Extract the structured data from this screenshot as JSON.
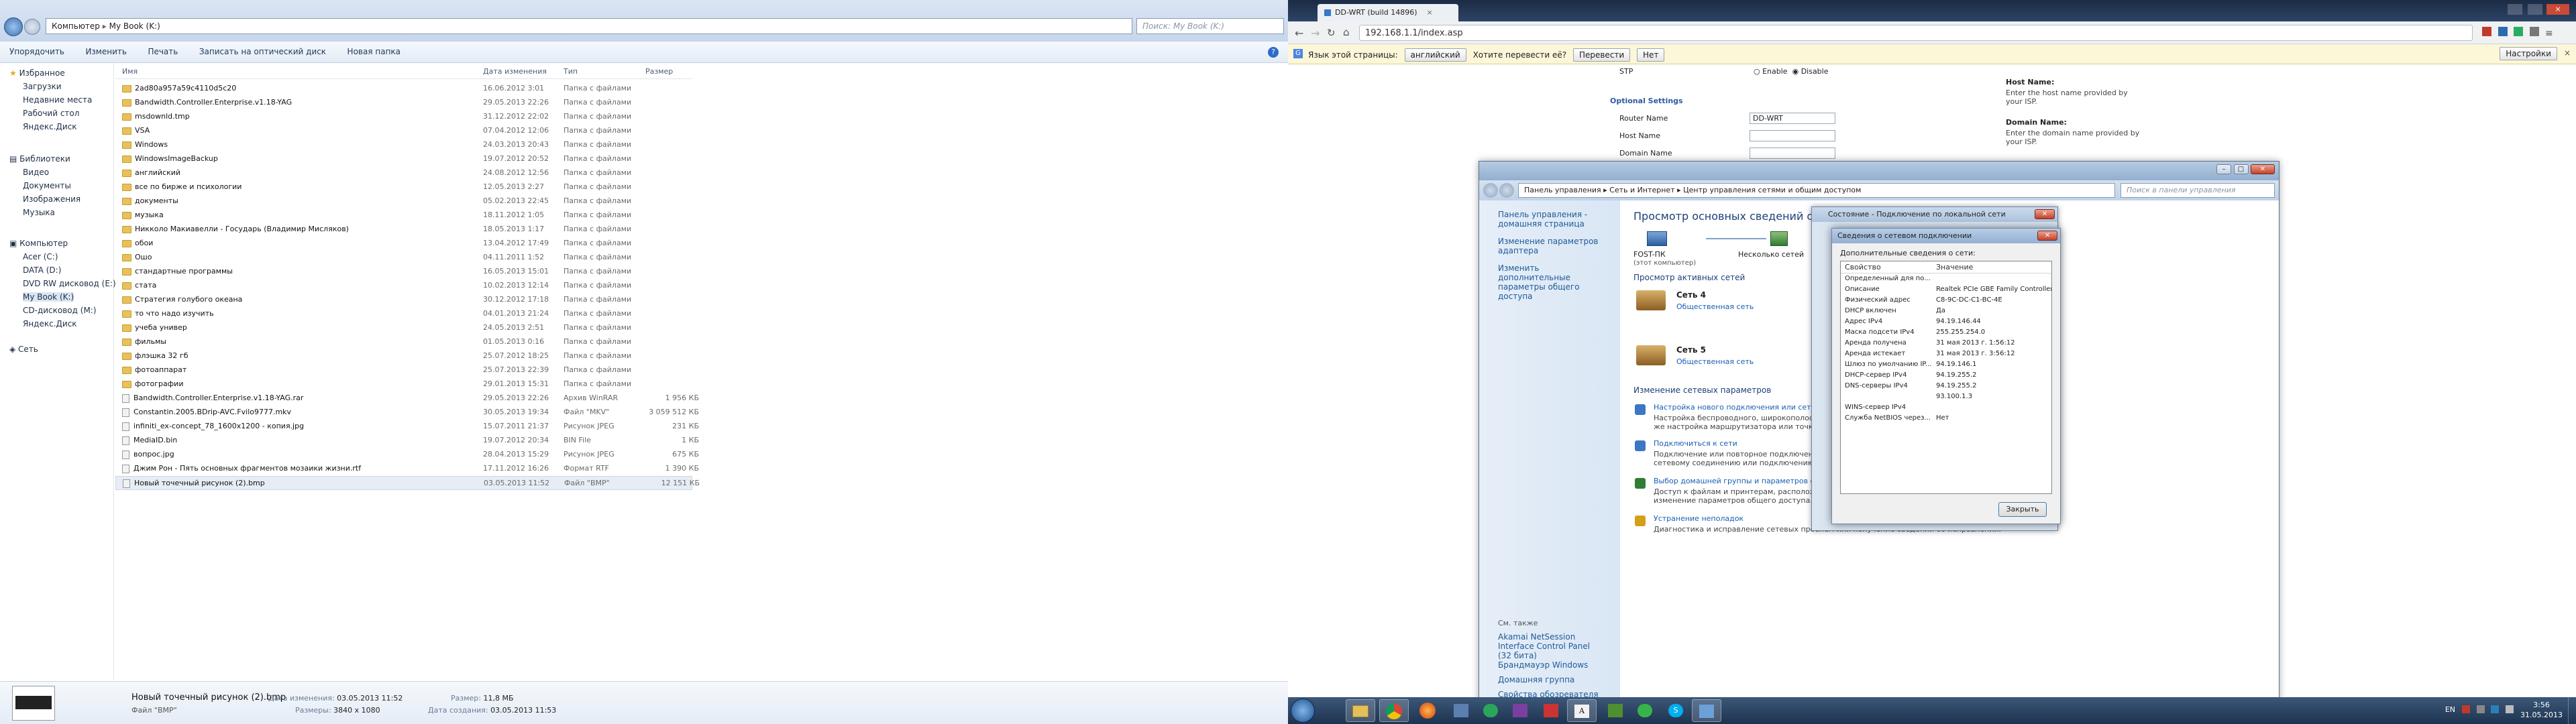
{
  "explorer": {
    "path_root": "Компьютер",
    "path_current": "My Book (K:)",
    "search_placeholder": "Поиск: My Book (K:)",
    "toolbar": [
      "Упорядочить",
      "Изменить",
      "Печать",
      "Записать на оптический диск",
      "Новая папка"
    ],
    "nav": {
      "favorites": "Избранное",
      "favorites_items": [
        "Загрузки",
        "Недавние места",
        "Рабочий стол",
        "Яндекс.Диск"
      ],
      "libraries": "Библиотеки",
      "libraries_items": [
        "Видео",
        "Документы",
        "Изображения",
        "Музыка"
      ],
      "computer": "Компьютер",
      "computer_items": [
        "Acer (C:)",
        "DATA (D:)",
        "DVD RW дисковод (E:)",
        "My Book (K:)",
        "CD-дисковод (M:)",
        "Яндекс.Диск"
      ],
      "network": "Сеть"
    },
    "columns": {
      "name": "Имя",
      "date": "Дата изменения",
      "type": "Тип",
      "size": "Размер"
    },
    "rows": [
      {
        "name": "2ad80a957a59c4110d5c20",
        "date": "16.06.2012 3:01",
        "type": "Папка с файлами",
        "size": "",
        "kind": "folder"
      },
      {
        "name": "Bandwidth.Controller.Enterprise.v1.18-YAG",
        "date": "29.05.2013 22:26",
        "type": "Папка с файлами",
        "size": "",
        "kind": "folder"
      },
      {
        "name": "msdownld.tmp",
        "date": "31.12.2012 22:02",
        "type": "Папка с файлами",
        "size": "",
        "kind": "folder"
      },
      {
        "name": "VSA",
        "date": "07.04.2012 12:06",
        "type": "Папка с файлами",
        "size": "",
        "kind": "folder"
      },
      {
        "name": "Windows",
        "date": "24.03.2013 20:43",
        "type": "Папка с файлами",
        "size": "",
        "kind": "folder"
      },
      {
        "name": "WindowsImageBackup",
        "date": "19.07.2012 20:52",
        "type": "Папка с файлами",
        "size": "",
        "kind": "folder"
      },
      {
        "name": "английский",
        "date": "24.08.2012 12:56",
        "type": "Папка с файлами",
        "size": "",
        "kind": "folder"
      },
      {
        "name": "все по бирже и психологии",
        "date": "12.05.2013 2:27",
        "type": "Папка с файлами",
        "size": "",
        "kind": "folder"
      },
      {
        "name": "документы",
        "date": "05.02.2013 22:45",
        "type": "Папка с файлами",
        "size": "",
        "kind": "folder"
      },
      {
        "name": "музыка",
        "date": "18.11.2012 1:05",
        "type": "Папка с файлами",
        "size": "",
        "kind": "folder"
      },
      {
        "name": "Никколо Макиавелли - Государь (Владимир Мисляков)",
        "date": "18.05.2013 1:17",
        "type": "Папка с файлами",
        "size": "",
        "kind": "folder"
      },
      {
        "name": "обои",
        "date": "13.04.2012 17:49",
        "type": "Папка с файлами",
        "size": "",
        "kind": "folder"
      },
      {
        "name": "Ошо",
        "date": "04.11.2011 1:52",
        "type": "Папка с файлами",
        "size": "",
        "kind": "folder"
      },
      {
        "name": "стандартные программы",
        "date": "16.05.2013 15:01",
        "type": "Папка с файлами",
        "size": "",
        "kind": "folder"
      },
      {
        "name": "стата",
        "date": "10.02.2013 12:14",
        "type": "Папка с файлами",
        "size": "",
        "kind": "folder"
      },
      {
        "name": "Стратегия голубого океана",
        "date": "30.12.2012 17:18",
        "type": "Папка с файлами",
        "size": "",
        "kind": "folder"
      },
      {
        "name": "то что надо изучить",
        "date": "04.01.2013 21:24",
        "type": "Папка с файлами",
        "size": "",
        "kind": "folder"
      },
      {
        "name": "учеба универ",
        "date": "24.05.2013 2:51",
        "type": "Папка с файлами",
        "size": "",
        "kind": "folder"
      },
      {
        "name": "фильмы",
        "date": "01.05.2013 0:16",
        "type": "Папка с файлами",
        "size": "",
        "kind": "folder"
      },
      {
        "name": "флэшка 32 гб",
        "date": "25.07.2012 18:25",
        "type": "Папка с файлами",
        "size": "",
        "kind": "folder"
      },
      {
        "name": "фотоаппарат",
        "date": "25.07.2013 22:39",
        "type": "Папка с файлами",
        "size": "",
        "kind": "folder"
      },
      {
        "name": "фотографии",
        "date": "29.01.2013 15:31",
        "type": "Папка с файлами",
        "size": "",
        "kind": "folder"
      },
      {
        "name": "Bandwidth.Controller.Enterprise.v1.18-YAG.rar",
        "date": "29.05.2013 22:26",
        "type": "Архив WinRAR",
        "size": "1 956 КБ",
        "kind": "file"
      },
      {
        "name": "Constantin.2005.BDrip-AVC.Fvilo9777.mkv",
        "date": "30.05.2013 19:34",
        "type": "Файл \"MKV\"",
        "size": "3 059 512 КБ",
        "kind": "file"
      },
      {
        "name": "infiniti_ex-concept_78_1600x1200 - копия.jpg",
        "date": "15.07.2011 21:37",
        "type": "Рисунок JPEG",
        "size": "231 КБ",
        "kind": "file"
      },
      {
        "name": "MediaID.bin",
        "date": "19.07.2012 20:34",
        "type": "BIN File",
        "size": "1 КБ",
        "kind": "file"
      },
      {
        "name": "вопрос.jpg",
        "date": "28.04.2013 15:29",
        "type": "Рисунок JPEG",
        "size": "675 КБ",
        "kind": "file"
      },
      {
        "name": "Джим Рон - Пять основных фрагментов мозаики жизни.rtf",
        "date": "17.11.2012 16:26",
        "type": "Формат RTF",
        "size": "1 390 КБ",
        "kind": "file"
      },
      {
        "name": "Новый точечный рисунок (2).bmp",
        "date": "03.05.2013 11:52",
        "type": "Файл \"BMP\"",
        "size": "12 151 КБ",
        "kind": "file"
      }
    ],
    "details": {
      "name": "Новый точечный рисунок (2).bmp",
      "type": "Файл \"BMP\"",
      "modified_label": "Дата изменения:",
      "modified": "03.05.2013 11:52",
      "size_label": "Размер:",
      "size": "11,8 МБ",
      "dims_label": "Размеры:",
      "dims": "3840 x 1080",
      "created_label": "Дата создания:",
      "created": "03.05.2013 11:53"
    }
  },
  "browser": {
    "tab_title": "DD-WRT (build 14896)",
    "url": "192.168.1.1/index.asp",
    "translate": {
      "prompt": "Язык этой страницы:",
      "lang": "английский",
      "question": "Хотите перевести её?",
      "translate_btn": "Перевести",
      "no_btn": "Нет",
      "settings_btn": "Настройки"
    },
    "ddwrt": {
      "stp_label": "STP",
      "enable": "Enable",
      "disable": "Disable",
      "section": "Optional Settings",
      "router_name_label": "Router Name",
      "router_name": "DD-WRT",
      "host_name_label": "Host Name",
      "domain_name_label": "Domain Name",
      "help1_title": "Host Name:",
      "help1_text": "Enter the host name provided by your ISP.",
      "help2_title": "Domain Name:",
      "help2_text": "Enter the domain name provided by your ISP."
    }
  },
  "control_panel": {
    "breadcrumb": [
      "Панель управления",
      "Сеть и Интернет",
      "Центр управления сетями и общим доступом"
    ],
    "search_placeholder": "Поиск в панели управления",
    "left": {
      "home": "Панель управления - домашняя страница",
      "adapter": "Изменение параметров адаптера",
      "sharing": "Изменить дополнительные параметры общего доступа",
      "see_also": "См. также",
      "akamai": "Akamai NetSession Interface Control Panel (32 бита)",
      "firewall": "Брандмауэр Windows",
      "homegroup": "Домашняя группа",
      "ie": "Свойства обозревателя"
    },
    "main": {
      "title": "Просмотр основных сведений о сети",
      "pc_name": "FOST-ПК",
      "pc_sub": "(этот компьютер)",
      "multi": "Несколько сетей",
      "active_title": "Просмотр активных сетей",
      "net4": "Сеть 4",
      "net4_type": "Общественная сеть",
      "net5": "Сеть 5",
      "net5_type": "Общественная сеть",
      "change_title": "Изменение сетевых параметров",
      "items": [
        {
          "link": "Настройка нового подключения или сети",
          "desc": "Настройка беспроводного, широкополосного, модемного, прямого или VPN-подключения или же настройка маршрутизатора или точки доступа."
        },
        {
          "link": "Подключиться к сети",
          "desc": "Подключение или повторное подключение к беспроводному, проводному, модемному сетевому соединению или подключению к VPN."
        },
        {
          "link": "Выбор домашней группы и параметров общего доступа",
          "desc": "Доступ к файлам и принтерам, расположенным на других сетевых компьютерах, или изменение параметров общего доступа."
        },
        {
          "link": "Устранение неполадок",
          "desc": "Диагностика и исправление сетевых проблем или получение сведений об исправлении."
        }
      ]
    }
  },
  "status_dialog": {
    "title": "Состояние - Подключение по локальной сети"
  },
  "details_dialog": {
    "title": "Сведения о сетевом подключении",
    "subtitle": "Дополнительные сведения о сети:",
    "col_prop": "Свойство",
    "col_val": "Значение",
    "rows": [
      [
        "Определенный для по...",
        ""
      ],
      [
        "Описание",
        "Realtek PCIe GBE Family Controller"
      ],
      [
        "Физический адрес",
        "C8-9C-DC-C1-BC-4E"
      ],
      [
        "DHCP включен",
        "Да"
      ],
      [
        "Адрес IPv4",
        "94.19.146.44"
      ],
      [
        "Маска подсети IPv4",
        "255.255.254.0"
      ],
      [
        "Аренда получена",
        "31 мая 2013 г. 1:56:12"
      ],
      [
        "Аренда истекает",
        "31 мая 2013 г. 3:56:12"
      ],
      [
        "Шлюз по умолчанию IP...",
        "94.19.146.1"
      ],
      [
        "DHCP-сервер IPv4",
        "94.19.255.2"
      ],
      [
        "DNS-серверы IPv4",
        "94.19.255.2"
      ],
      [
        "",
        "93.100.1.3"
      ],
      [
        "WINS-сервер IPv4",
        ""
      ],
      [
        "Служба NetBIOS через...",
        "Нет"
      ]
    ],
    "close_btn": "Закрыть"
  },
  "taskbar": {
    "lang": "EN",
    "time": "3:56",
    "date": "31.05.2013"
  }
}
